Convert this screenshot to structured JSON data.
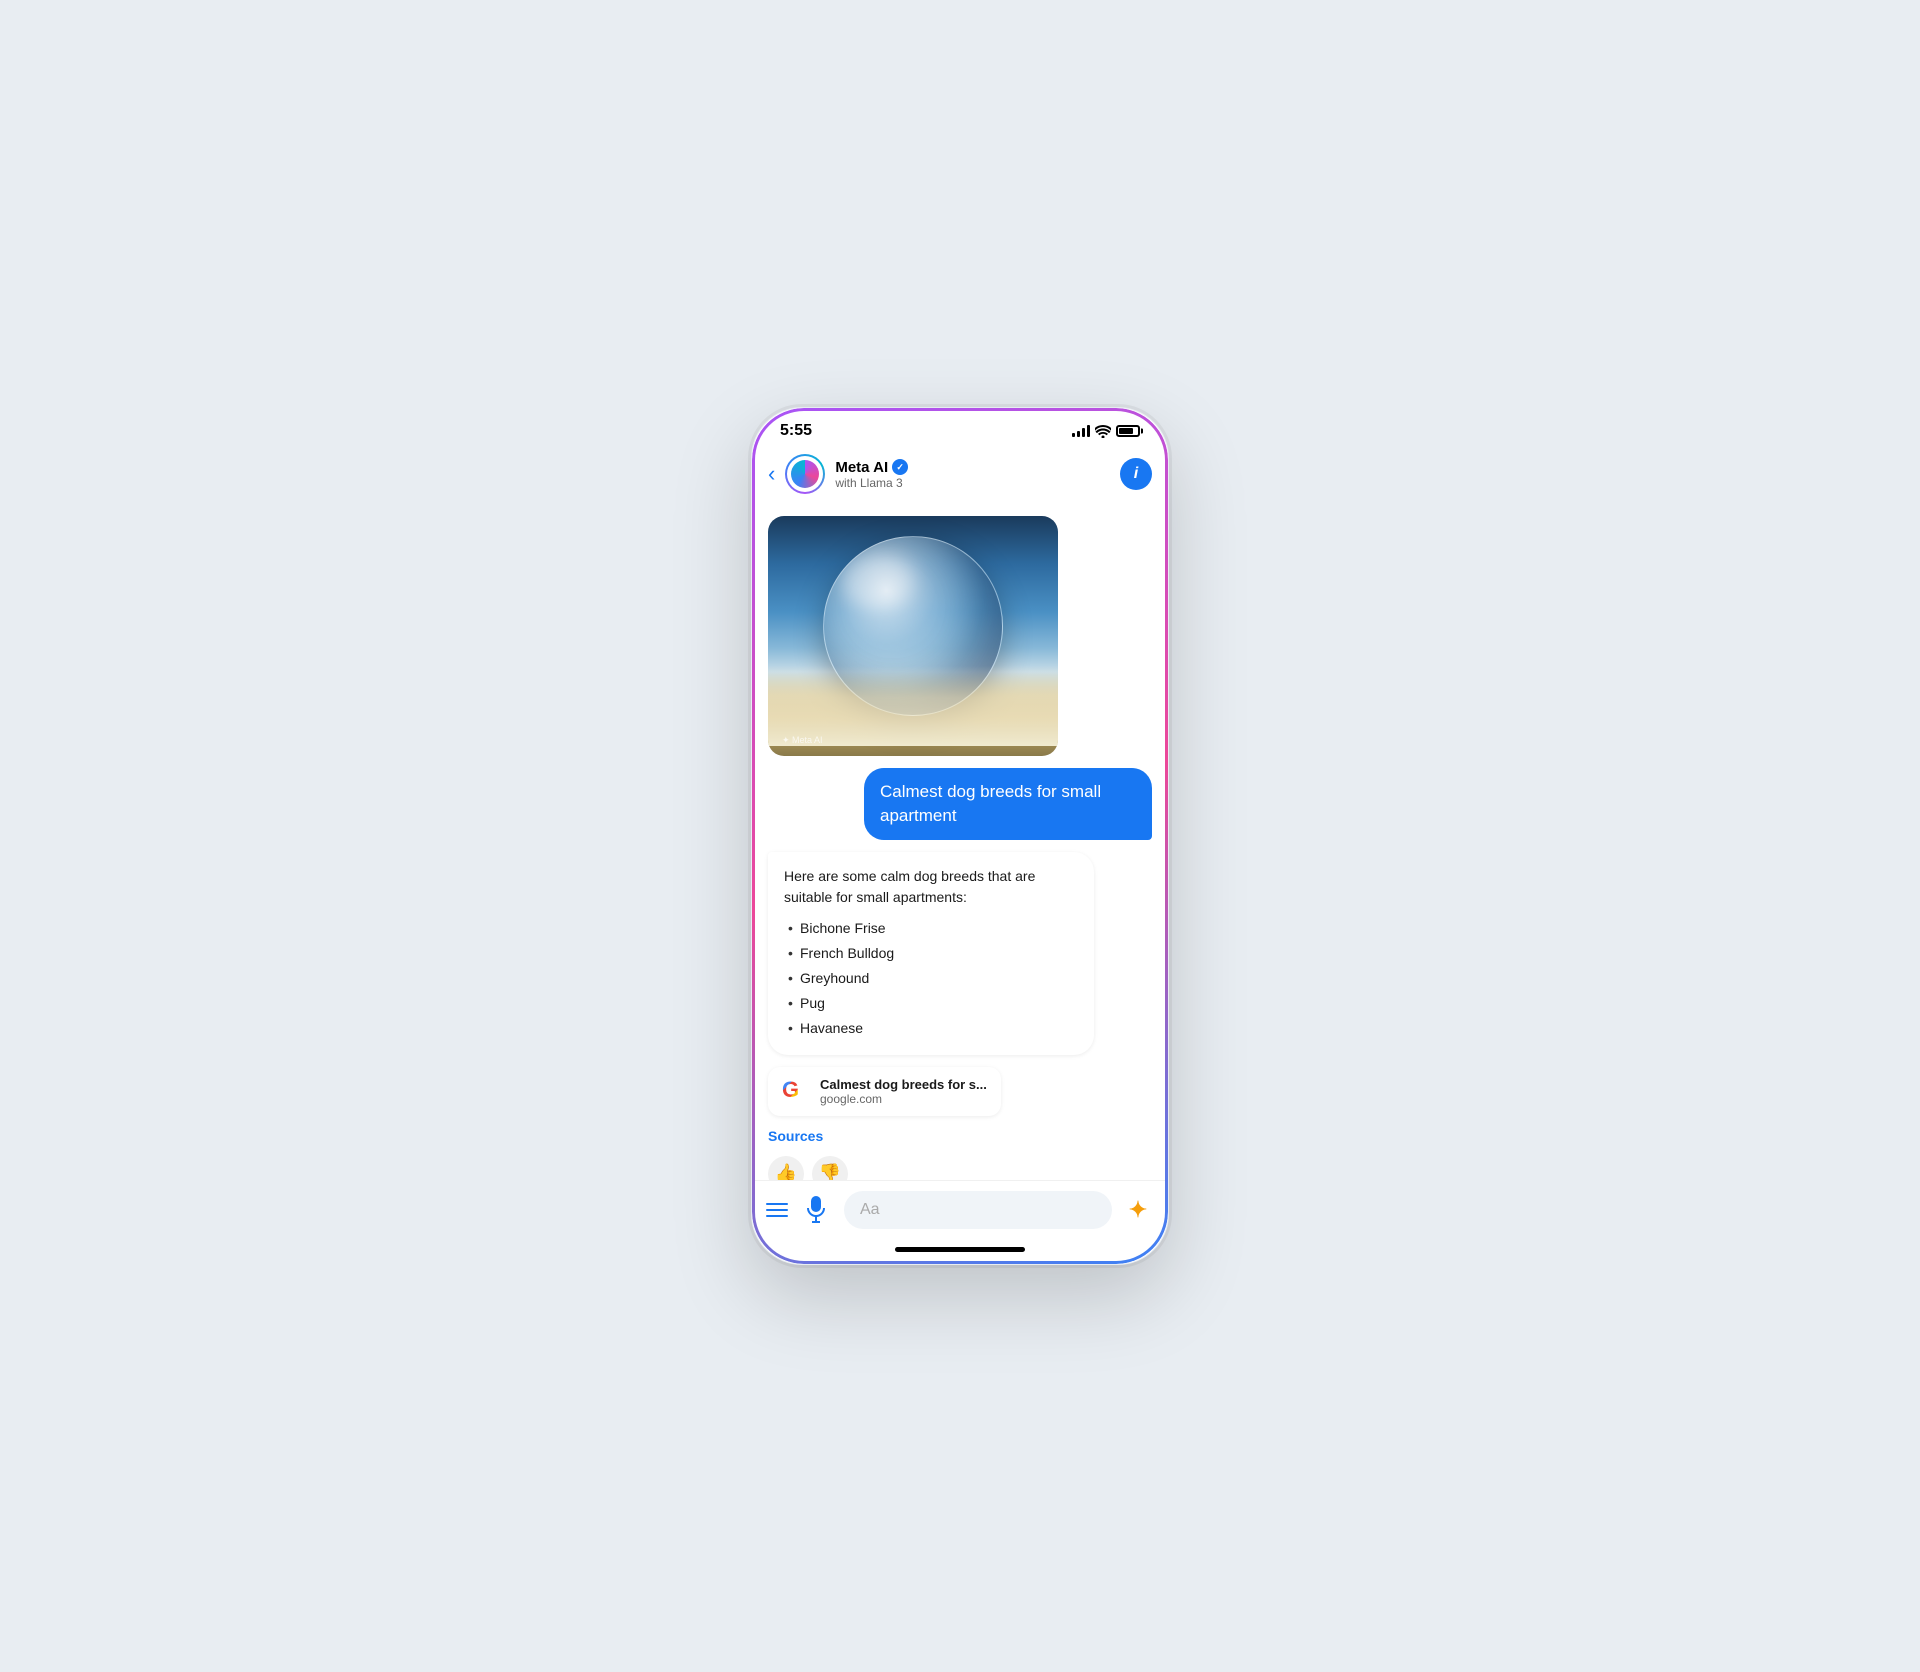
{
  "status": {
    "time": "5:55",
    "signal_label": "signal",
    "wifi_label": "wifi",
    "battery_label": "battery"
  },
  "header": {
    "back_label": "‹",
    "ai_name": "Meta AI",
    "ai_subtitle": "with Llama 3",
    "info_label": "i"
  },
  "image": {
    "watermark": "✦ Meta AI"
  },
  "user_message": {
    "text": "Calmest dog breeds for small apartment"
  },
  "ai_response": {
    "intro": "Here are some calm dog breeds that are suitable for small apartments:",
    "breeds": [
      "Bichone Frise",
      "French Bulldog",
      "Greyhound",
      "Pug",
      "Havanese"
    ]
  },
  "source_card": {
    "title": "Calmest dog breeds for s...",
    "url": "google.com"
  },
  "sources_label": "Sources",
  "feedback": {
    "thumbs_up": "👍",
    "thumbs_down": "👎"
  },
  "input": {
    "placeholder": "Aa"
  },
  "sparkle": "✦",
  "google_g": "G"
}
